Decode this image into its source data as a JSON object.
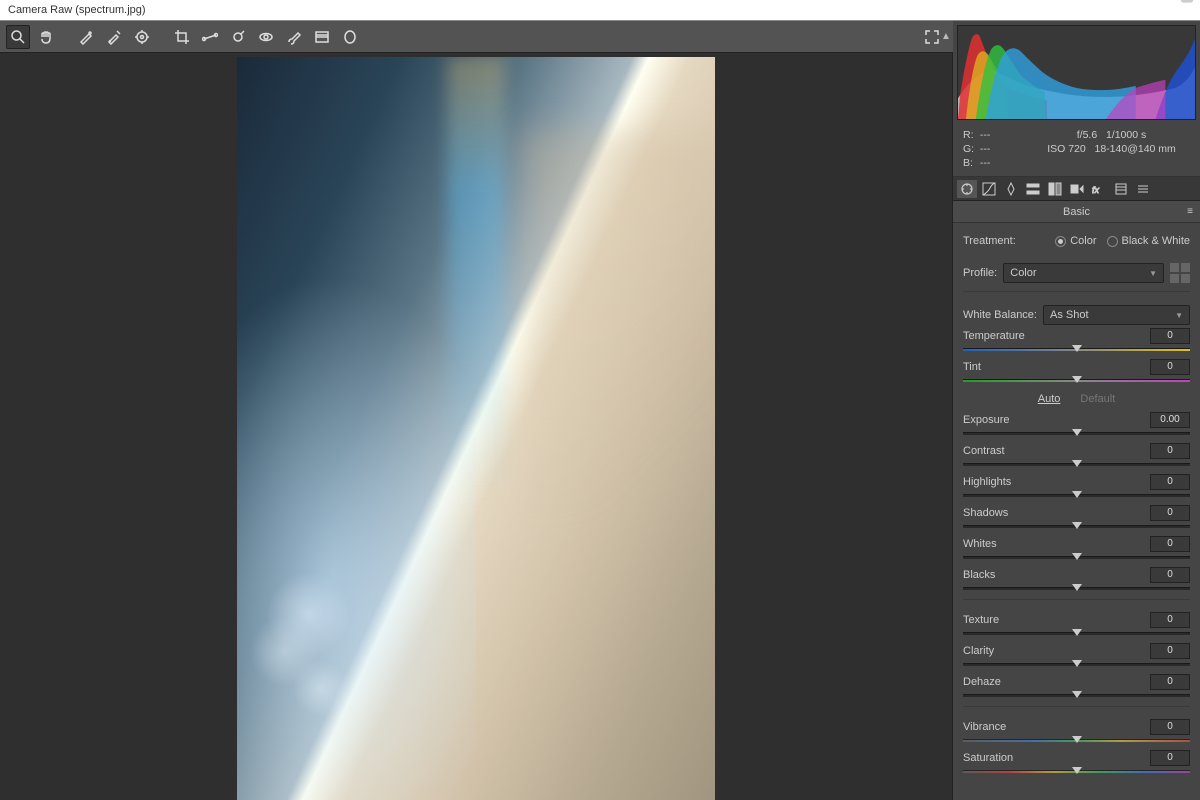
{
  "window": {
    "title": "Camera Raw (spectrum.jpg)"
  },
  "toolbar": {
    "tools": [
      "zoom",
      "hand",
      "white-balance",
      "color-sampler",
      "target-adjust",
      "crop",
      "straighten",
      "spot-removal",
      "red-eye",
      "adjustment-brush",
      "graduated-filter",
      "radial-filter"
    ]
  },
  "exif": {
    "r": "---",
    "g": "---",
    "b": "---",
    "aperture": "f/5.6",
    "shutter": "1/1000 s",
    "iso": "ISO 720",
    "lens": "18-140@140 mm"
  },
  "panel": {
    "title": "Basic",
    "treatment_label": "Treatment:",
    "treatment_color": "Color",
    "treatment_bw": "Black & White",
    "profile_label": "Profile:",
    "profile_value": "Color",
    "wb_label": "White Balance:",
    "wb_value": "As Shot",
    "auto": "Auto",
    "default": "Default"
  },
  "sliders": {
    "temperature": {
      "label": "Temperature",
      "value": "0",
      "pos": 50
    },
    "tint": {
      "label": "Tint",
      "value": "0",
      "pos": 50
    },
    "exposure": {
      "label": "Exposure",
      "value": "0.00",
      "pos": 50
    },
    "contrast": {
      "label": "Contrast",
      "value": "0",
      "pos": 50
    },
    "highlights": {
      "label": "Highlights",
      "value": "0",
      "pos": 50
    },
    "shadows": {
      "label": "Shadows",
      "value": "0",
      "pos": 50
    },
    "whites": {
      "label": "Whites",
      "value": "0",
      "pos": 50
    },
    "blacks": {
      "label": "Blacks",
      "value": "0",
      "pos": 50
    },
    "texture": {
      "label": "Texture",
      "value": "0",
      "pos": 50
    },
    "clarity": {
      "label": "Clarity",
      "value": "0",
      "pos": 50
    },
    "dehaze": {
      "label": "Dehaze",
      "value": "0",
      "pos": 50
    },
    "vibrance": {
      "label": "Vibrance",
      "value": "0",
      "pos": 50
    },
    "saturation": {
      "label": "Saturation",
      "value": "0",
      "pos": 50
    }
  }
}
